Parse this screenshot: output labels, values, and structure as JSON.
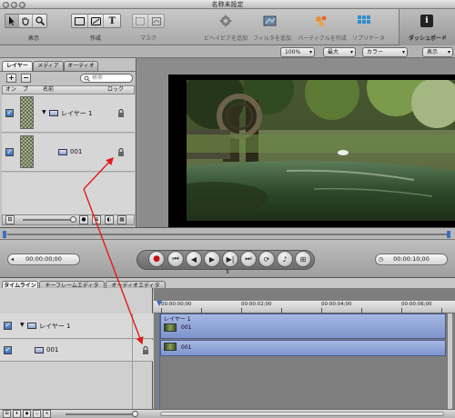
{
  "window": {
    "title": "名称未設定"
  },
  "toolbar": {
    "labels": {
      "display": "表示",
      "create": "作成",
      "mask": "マスク",
      "add_behavior": "ビヘイビアを追加",
      "add_filter": "フィルタを追加",
      "make_particles": "パーティクルを作成",
      "replicator": "リプリケータ",
      "dashboard": "ダッシュボード"
    },
    "icons": [
      "arrow-select-icon",
      "hand-icon",
      "zoom-icon",
      "rectangle-icon",
      "ellipse-icon",
      "text-icon",
      "mask-icon",
      "behavior-gear-icon",
      "filter-icon",
      "particles-icon",
      "replicator-icon",
      "dashboard-info-icon"
    ]
  },
  "settings": {
    "zoom": "100%",
    "quality": "最大",
    "channel": "カラー",
    "view": "表示"
  },
  "layers_panel": {
    "tabs": [
      "レイヤー",
      "メディア",
      "オーディオ"
    ],
    "active_tab": "レイヤー",
    "search_placeholder": "検索",
    "columns": {
      "on": "オン",
      "preview": "プ",
      "name": "名前",
      "lock": "ロック"
    },
    "rows": [
      {
        "name": "レイヤー 1",
        "type": "group",
        "enabled": true
      },
      {
        "name": "001",
        "type": "clip",
        "enabled": true
      }
    ]
  },
  "transport": {
    "current_time": "00:00:00;00",
    "duration": "00:00:10;00"
  },
  "timeline_panel": {
    "tabs": [
      "タイムライン",
      "キーフレームエディタ",
      "オーディオエディタ"
    ],
    "active_tab": "タイムライン",
    "rows": [
      {
        "name": "レイヤー 1",
        "type": "group",
        "enabled": true
      },
      {
        "name": "001",
        "type": "clip",
        "enabled": true
      }
    ],
    "ruler": [
      "00:00:00;00",
      "00:00:02;00",
      "00:00:04;00",
      "00:00:06;00"
    ],
    "tracks": [
      {
        "group_label": "レイヤー 1",
        "clip_label": "001"
      },
      {
        "clip_label": "001"
      }
    ]
  },
  "colors": {
    "accent_blue": "#3b6fbd",
    "track_blue": "#8fa5d6",
    "annotation_red": "#e01c1c",
    "record_red": "#c51010"
  }
}
